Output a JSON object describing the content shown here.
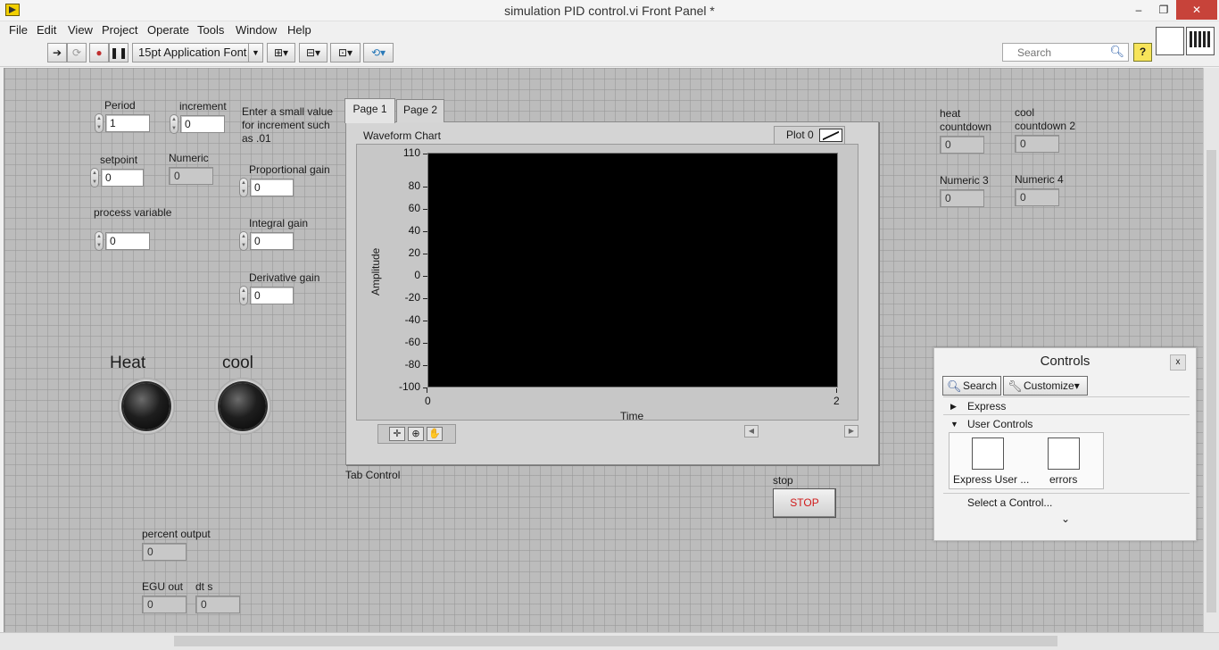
{
  "window": {
    "title": "simulation PID control.vi Front Panel *",
    "minimize": "–",
    "restore": "❐",
    "close": "✕"
  },
  "menu": [
    "File",
    "Edit",
    "View",
    "Project",
    "Operate",
    "Tools",
    "Window",
    "Help"
  ],
  "toolbar": {
    "font": "15pt Application Font",
    "search_placeholder": "Search",
    "help": "?"
  },
  "controls": {
    "period": {
      "label": "Period",
      "value": "1"
    },
    "increment": {
      "label": "increment",
      "value": "0"
    },
    "note": [
      "Enter a small value",
      "for increment such",
      "as .01"
    ],
    "setpoint": {
      "label": "setpoint",
      "value": "0"
    },
    "numeric": {
      "label": "Numeric",
      "value": "0"
    },
    "process_variable": {
      "label": "process variable",
      "value": "0"
    },
    "proportional_gain": {
      "label": "Proportional gain",
      "value": "0"
    },
    "integral_gain": {
      "label": "Integral  gain",
      "value": "0"
    },
    "derivative_gain": {
      "label": "Derivative gain",
      "value": "0"
    },
    "heat_countdown": {
      "label": [
        "heat",
        "countdown"
      ],
      "value": "0"
    },
    "cool_countdown_2": {
      "label": [
        "cool",
        "countdown 2"
      ],
      "value": "0"
    },
    "numeric_3": {
      "label": "Numeric 3",
      "value": "0"
    },
    "numeric_4": {
      "label": "Numeric 4",
      "value": "0"
    },
    "percent_output": {
      "label": "percent output",
      "value": "0"
    },
    "egu_out": {
      "label": "EGU out",
      "value": "0"
    },
    "dt_s": {
      "label": "dt s",
      "value": "0"
    },
    "heat_led": {
      "label": "Heat"
    },
    "cool_led": {
      "label": "cool"
    },
    "stop": {
      "label": "stop",
      "button": "STOP"
    }
  },
  "tab_control": {
    "label": "Tab Control",
    "tabs": [
      "Page 1",
      "Page 2"
    ],
    "active": 0
  },
  "chart_data": {
    "type": "line",
    "title": "Waveform Chart",
    "xlabel": "Time",
    "ylabel": "Amplitude",
    "xlim": [
      0,
      2
    ],
    "ylim": [
      -100,
      110
    ],
    "y_ticks": [
      "110",
      "80",
      "60",
      "40",
      "20",
      "0",
      "-20",
      "-40",
      "-60",
      "-80",
      "-100"
    ],
    "x_ticks": [
      "0",
      "2"
    ],
    "series": [
      {
        "name": "Plot 0",
        "values": []
      }
    ],
    "background": "#000000",
    "grid": false,
    "legend": "top-right"
  },
  "controls_palette": {
    "title": "Controls",
    "close": "x",
    "search": "Search",
    "customize": "Customize",
    "categories": [
      "Express",
      "User Controls"
    ],
    "items": [
      "Express User ...",
      "errors"
    ],
    "select": "Select a Control...",
    "more": "⌄"
  }
}
